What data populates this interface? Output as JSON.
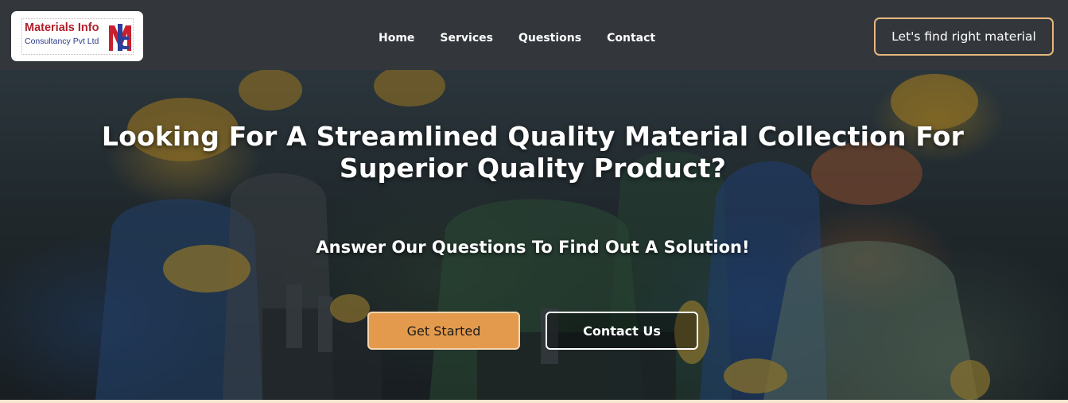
{
  "brand": {
    "name": "Materials Info",
    "tagline": "Consultancy Pvt Ltd",
    "logo_icon": "mic-monogram-logo",
    "colors": {
      "red": "#b01f2a",
      "blue": "#2a3a8a"
    }
  },
  "nav": {
    "links": [
      "Home",
      "Services",
      "Questions",
      "Contact"
    ],
    "cta_label": "Let's find right material"
  },
  "hero": {
    "title": "Looking For A Streamlined Quality Material Collection For Superior Quality Product?",
    "subtitle": "Answer Our Questions To Find Out A Solution!",
    "primary_button": "Get Started",
    "secondary_button": "Contact Us",
    "background_image": "factory-workers-hardhats-photo"
  },
  "colors": {
    "navbar": "#33373c",
    "accent": "#e39a4d",
    "accent_border": "#e7b77e",
    "page_bg": "#f6e6cf"
  }
}
